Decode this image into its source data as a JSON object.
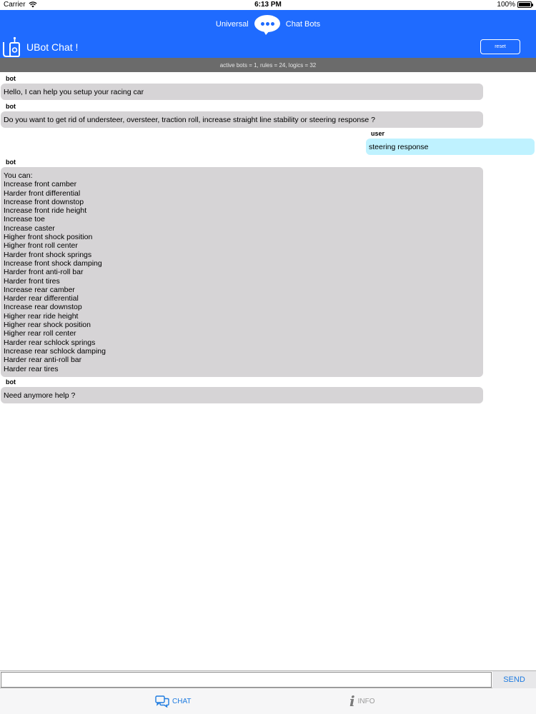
{
  "status_bar": {
    "carrier": "Carrier",
    "time": "6:13 PM",
    "battery": "100%"
  },
  "header": {
    "brand_left": "Universal",
    "brand_right": "Chat Bots",
    "app_title": "UBot Chat !",
    "reset_label": "reset",
    "info": "active bots = 1, rules = 24, logics = 32"
  },
  "messages": [
    {
      "sender": "bot",
      "text": "Hello, I can help you setup your racing car"
    },
    {
      "sender": "bot",
      "text": "Do you want to get rid of understeer, oversteer, traction roll, increase straight line stability or steering response ?"
    },
    {
      "sender": "user",
      "text": "steering response"
    },
    {
      "sender": "bot",
      "text": "You can:\nIncrease front camber\nHarder front differential\nIncrease front downstop\nIncrease front ride height\nIncrease toe\nIncrease caster\nHigher front shock position\nHigher front roll center\nHarder front shock springs\nIncrease front shock damping\nHarder front anti-roll bar\nHarder front tires\nIncrease rear camber\nHarder rear differential\nIncrease rear downstop\nHigher rear ride height\nHigher rear shock position\nHigher rear roll center\nHarder rear schlock springs\nIncrease rear schlock damping\nHarder rear anti-roll bar\nHarder rear tires"
    },
    {
      "sender": "bot",
      "text": "Need anymore help ?"
    }
  ],
  "composer": {
    "value": "",
    "send_label": "SEND"
  },
  "tabs": [
    {
      "label": "CHAT",
      "icon": "chat-icon",
      "active": true
    },
    {
      "label": "INFO",
      "icon": "info-icon",
      "active": false
    }
  ],
  "colors": {
    "header": "#1f6bff",
    "info_bar": "#6b6b6b",
    "bot_bubble": "#d6d4d6",
    "user_bubble": "#bff2ff",
    "accent": "#1e7be0"
  }
}
